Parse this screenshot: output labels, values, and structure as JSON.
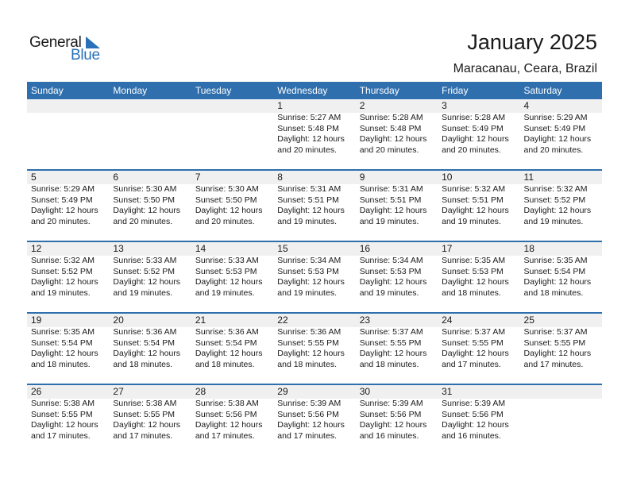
{
  "logo": {
    "word1": "General",
    "word2": "Blue",
    "accent_color": "#2970b8"
  },
  "header": {
    "title": "January 2025",
    "location": "Maracanau, Ceara, Brazil"
  },
  "colors": {
    "header_bg": "#2f6fae",
    "band_bg": "#f0f0f0"
  },
  "weekdays": [
    "Sunday",
    "Monday",
    "Tuesday",
    "Wednesday",
    "Thursday",
    "Friday",
    "Saturday"
  ],
  "weeks": [
    [
      null,
      null,
      null,
      {
        "day": "1",
        "sunrise": "Sunrise: 5:27 AM",
        "sunset": "Sunset: 5:48 PM",
        "daylight1": "Daylight: 12 hours",
        "daylight2": "and 20 minutes."
      },
      {
        "day": "2",
        "sunrise": "Sunrise: 5:28 AM",
        "sunset": "Sunset: 5:48 PM",
        "daylight1": "Daylight: 12 hours",
        "daylight2": "and 20 minutes."
      },
      {
        "day": "3",
        "sunrise": "Sunrise: 5:28 AM",
        "sunset": "Sunset: 5:49 PM",
        "daylight1": "Daylight: 12 hours",
        "daylight2": "and 20 minutes."
      },
      {
        "day": "4",
        "sunrise": "Sunrise: 5:29 AM",
        "sunset": "Sunset: 5:49 PM",
        "daylight1": "Daylight: 12 hours",
        "daylight2": "and 20 minutes."
      }
    ],
    [
      {
        "day": "5",
        "sunrise": "Sunrise: 5:29 AM",
        "sunset": "Sunset: 5:49 PM",
        "daylight1": "Daylight: 12 hours",
        "daylight2": "and 20 minutes."
      },
      {
        "day": "6",
        "sunrise": "Sunrise: 5:30 AM",
        "sunset": "Sunset: 5:50 PM",
        "daylight1": "Daylight: 12 hours",
        "daylight2": "and 20 minutes."
      },
      {
        "day": "7",
        "sunrise": "Sunrise: 5:30 AM",
        "sunset": "Sunset: 5:50 PM",
        "daylight1": "Daylight: 12 hours",
        "daylight2": "and 20 minutes."
      },
      {
        "day": "8",
        "sunrise": "Sunrise: 5:31 AM",
        "sunset": "Sunset: 5:51 PM",
        "daylight1": "Daylight: 12 hours",
        "daylight2": "and 19 minutes."
      },
      {
        "day": "9",
        "sunrise": "Sunrise: 5:31 AM",
        "sunset": "Sunset: 5:51 PM",
        "daylight1": "Daylight: 12 hours",
        "daylight2": "and 19 minutes."
      },
      {
        "day": "10",
        "sunrise": "Sunrise: 5:32 AM",
        "sunset": "Sunset: 5:51 PM",
        "daylight1": "Daylight: 12 hours",
        "daylight2": "and 19 minutes."
      },
      {
        "day": "11",
        "sunrise": "Sunrise: 5:32 AM",
        "sunset": "Sunset: 5:52 PM",
        "daylight1": "Daylight: 12 hours",
        "daylight2": "and 19 minutes."
      }
    ],
    [
      {
        "day": "12",
        "sunrise": "Sunrise: 5:32 AM",
        "sunset": "Sunset: 5:52 PM",
        "daylight1": "Daylight: 12 hours",
        "daylight2": "and 19 minutes."
      },
      {
        "day": "13",
        "sunrise": "Sunrise: 5:33 AM",
        "sunset": "Sunset: 5:52 PM",
        "daylight1": "Daylight: 12 hours",
        "daylight2": "and 19 minutes."
      },
      {
        "day": "14",
        "sunrise": "Sunrise: 5:33 AM",
        "sunset": "Sunset: 5:53 PM",
        "daylight1": "Daylight: 12 hours",
        "daylight2": "and 19 minutes."
      },
      {
        "day": "15",
        "sunrise": "Sunrise: 5:34 AM",
        "sunset": "Sunset: 5:53 PM",
        "daylight1": "Daylight: 12 hours",
        "daylight2": "and 19 minutes."
      },
      {
        "day": "16",
        "sunrise": "Sunrise: 5:34 AM",
        "sunset": "Sunset: 5:53 PM",
        "daylight1": "Daylight: 12 hours",
        "daylight2": "and 19 minutes."
      },
      {
        "day": "17",
        "sunrise": "Sunrise: 5:35 AM",
        "sunset": "Sunset: 5:53 PM",
        "daylight1": "Daylight: 12 hours",
        "daylight2": "and 18 minutes."
      },
      {
        "day": "18",
        "sunrise": "Sunrise: 5:35 AM",
        "sunset": "Sunset: 5:54 PM",
        "daylight1": "Daylight: 12 hours",
        "daylight2": "and 18 minutes."
      }
    ],
    [
      {
        "day": "19",
        "sunrise": "Sunrise: 5:35 AM",
        "sunset": "Sunset: 5:54 PM",
        "daylight1": "Daylight: 12 hours",
        "daylight2": "and 18 minutes."
      },
      {
        "day": "20",
        "sunrise": "Sunrise: 5:36 AM",
        "sunset": "Sunset: 5:54 PM",
        "daylight1": "Daylight: 12 hours",
        "daylight2": "and 18 minutes."
      },
      {
        "day": "21",
        "sunrise": "Sunrise: 5:36 AM",
        "sunset": "Sunset: 5:54 PM",
        "daylight1": "Daylight: 12 hours",
        "daylight2": "and 18 minutes."
      },
      {
        "day": "22",
        "sunrise": "Sunrise: 5:36 AM",
        "sunset": "Sunset: 5:55 PM",
        "daylight1": "Daylight: 12 hours",
        "daylight2": "and 18 minutes."
      },
      {
        "day": "23",
        "sunrise": "Sunrise: 5:37 AM",
        "sunset": "Sunset: 5:55 PM",
        "daylight1": "Daylight: 12 hours",
        "daylight2": "and 18 minutes."
      },
      {
        "day": "24",
        "sunrise": "Sunrise: 5:37 AM",
        "sunset": "Sunset: 5:55 PM",
        "daylight1": "Daylight: 12 hours",
        "daylight2": "and 17 minutes."
      },
      {
        "day": "25",
        "sunrise": "Sunrise: 5:37 AM",
        "sunset": "Sunset: 5:55 PM",
        "daylight1": "Daylight: 12 hours",
        "daylight2": "and 17 minutes."
      }
    ],
    [
      {
        "day": "26",
        "sunrise": "Sunrise: 5:38 AM",
        "sunset": "Sunset: 5:55 PM",
        "daylight1": "Daylight: 12 hours",
        "daylight2": "and 17 minutes."
      },
      {
        "day": "27",
        "sunrise": "Sunrise: 5:38 AM",
        "sunset": "Sunset: 5:55 PM",
        "daylight1": "Daylight: 12 hours",
        "daylight2": "and 17 minutes."
      },
      {
        "day": "28",
        "sunrise": "Sunrise: 5:38 AM",
        "sunset": "Sunset: 5:56 PM",
        "daylight1": "Daylight: 12 hours",
        "daylight2": "and 17 minutes."
      },
      {
        "day": "29",
        "sunrise": "Sunrise: 5:39 AM",
        "sunset": "Sunset: 5:56 PM",
        "daylight1": "Daylight: 12 hours",
        "daylight2": "and 17 minutes."
      },
      {
        "day": "30",
        "sunrise": "Sunrise: 5:39 AM",
        "sunset": "Sunset: 5:56 PM",
        "daylight1": "Daylight: 12 hours",
        "daylight2": "and 16 minutes."
      },
      {
        "day": "31",
        "sunrise": "Sunrise: 5:39 AM",
        "sunset": "Sunset: 5:56 PM",
        "daylight1": "Daylight: 12 hours",
        "daylight2": "and 16 minutes."
      },
      null
    ]
  ]
}
